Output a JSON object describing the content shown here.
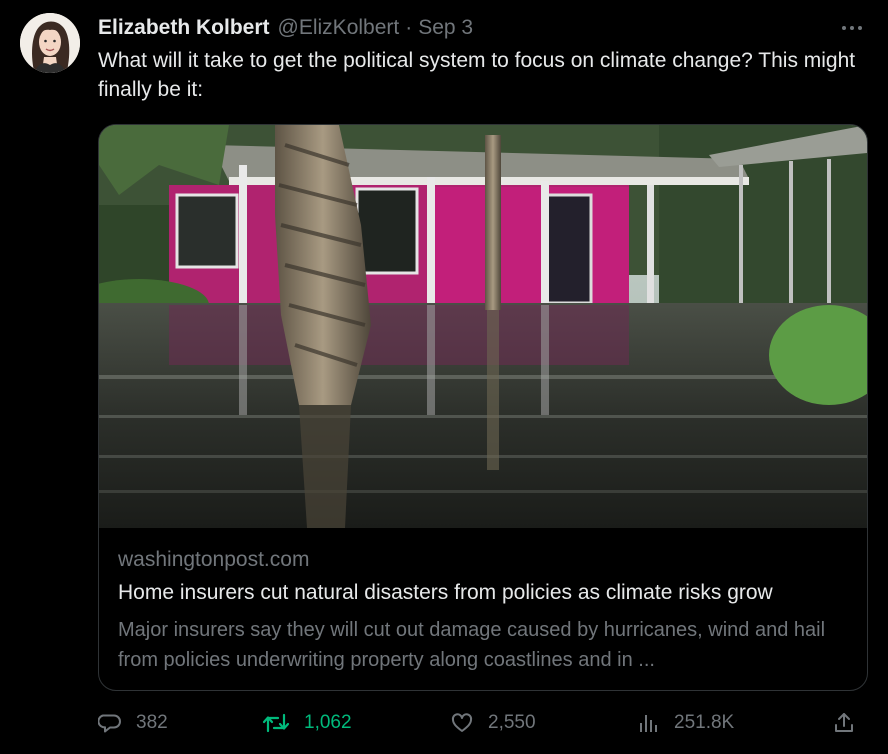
{
  "author": {
    "name": "Elizabeth Kolbert",
    "handle": "@ElizKolbert",
    "separator": "·",
    "date": "Sep 3"
  },
  "tweet": {
    "text": "What will it take to get the political system to focus on climate change? This might finally be it:"
  },
  "card": {
    "domain": "washingtonpost.com",
    "title": "Home insurers cut natural disasters from policies as climate risks grow",
    "description": "Major insurers say they will cut out damage caused by hurricanes, wind and hail from policies underwriting property along coastlines and in ..."
  },
  "actions": {
    "replies": "382",
    "retweets": "1,062",
    "likes": "2,550",
    "views": "251.8K"
  },
  "icons": {
    "more": "more-dots-icon",
    "reply": "reply-bubble-icon",
    "retweet": "retweet-arrows-icon",
    "like": "heart-icon",
    "views": "bar-chart-icon",
    "share": "share-upload-icon"
  },
  "colors": {
    "background": "#000000",
    "text": "#e7e9ea",
    "muted": "#71767b",
    "retweet_active": "#00ba7c",
    "border": "#2f3336"
  }
}
